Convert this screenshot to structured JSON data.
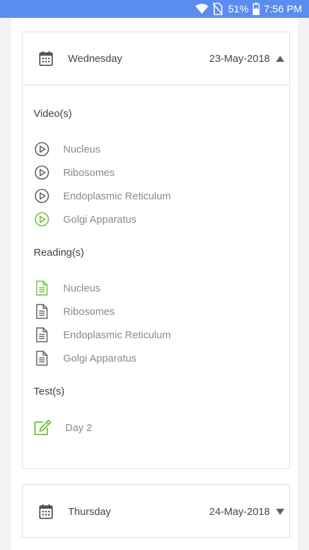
{
  "status_bar": {
    "battery_percent": "51%",
    "time": "7:56 PM",
    "icons": [
      "wifi-icon",
      "no-sim-icon",
      "battery-charging-icon"
    ]
  },
  "colors": {
    "status_bar": "#5b8def",
    "active_green": "#6cbf3a",
    "icon_gray": "#5f5f5f"
  },
  "schedule": [
    {
      "day": "Wednesday",
      "date": "23-May-2018",
      "expanded": true,
      "sections": {
        "videos": {
          "title": "Video(s)",
          "items": [
            {
              "label": "Nucleus",
              "icon": "play-circle-icon",
              "active": false
            },
            {
              "label": "Ribosomes",
              "icon": "play-circle-icon",
              "active": false
            },
            {
              "label": "Endoplasmic Reticulum",
              "icon": "play-circle-icon",
              "active": false
            },
            {
              "label": "Golgi Apparatus",
              "icon": "play-circle-icon",
              "active": true
            }
          ]
        },
        "readings": {
          "title": "Reading(s)",
          "items": [
            {
              "label": "Nucleus",
              "icon": "document-icon",
              "active": true
            },
            {
              "label": "Ribosomes",
              "icon": "document-icon",
              "active": false
            },
            {
              "label": "Endoplasmic Reticulum",
              "icon": "document-icon",
              "active": false
            },
            {
              "label": "Golgi Apparatus",
              "icon": "document-icon",
              "active": false
            }
          ]
        },
        "tests": {
          "title": "Test(s)",
          "items": [
            {
              "label": "Day 2",
              "icon": "edit-icon",
              "active": true
            }
          ]
        }
      }
    },
    {
      "day": "Thursday",
      "date": "24-May-2018",
      "expanded": false
    }
  ]
}
